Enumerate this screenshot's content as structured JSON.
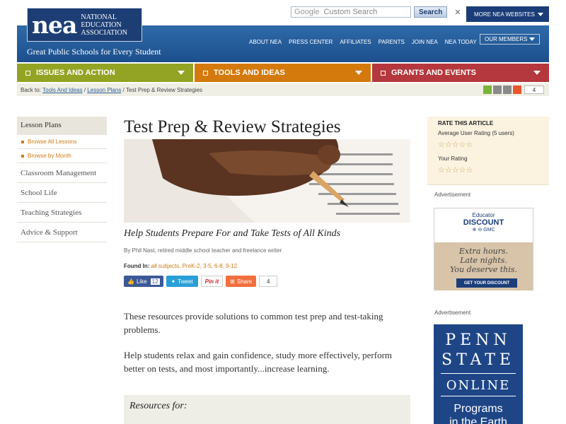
{
  "search": {
    "brand": "Google",
    "placeholder": "Custom Search",
    "button": "Search",
    "clear": "✕"
  },
  "more_sites": "MORE NEA WEBSITES",
  "logo": {
    "mark": "nea",
    "line1": "NATIONAL",
    "line2": "EDUCATION",
    "line3": "ASSOCIATION"
  },
  "tagline": "Great Public Schools for Every Student",
  "topnav": [
    "ABOUT NEA",
    "PRESS CENTER",
    "AFFILIATES",
    "PARENTS",
    "JOIN NEA",
    "NEA TODAY"
  ],
  "members": "OUR MEMBERS",
  "nav": [
    {
      "label": "ISSUES AND ACTION",
      "color": "#93a324"
    },
    {
      "label": "TOOLS AND IDEAS",
      "color": "#d47a0c"
    },
    {
      "label": "GRANTS AND EVENTS",
      "color": "#b4383d"
    }
  ],
  "breadcrumb": {
    "prefix": "Back to:",
    "link1": "Tools And Ideas",
    "sep1": " / ",
    "link2": "Lesson Plans",
    "sep2": " / ",
    "current": "Test Prep & Review Strategies"
  },
  "share_count": "4",
  "sidebar": {
    "heading": "Lesson Plans",
    "subs": [
      "Browse All Lessons",
      "Browse by Month"
    ],
    "items": [
      "Classroom Management",
      "School Life",
      "Teaching Strategies",
      "Advice & Support"
    ]
  },
  "article": {
    "title": "Test Prep & Review Strategies",
    "subtitle": "Help Students Prepare For and Take Tests of All Kinds",
    "byline": "By Phil Nast, retired middle school teacher and freelance writer",
    "found_label": "Found In:",
    "found_in": "all subjects, PreK-2, 3-5, 6-8, 9-12",
    "para1": "These resources provide solutions to common test prep and test-taking problems.",
    "para2": "Help students relax and gain confidence, study more effectively, perform better on tests, and most importantly...increase learning.",
    "resources": "Resources for:"
  },
  "social": {
    "like": "Like",
    "like_count": "12",
    "tweet": "Tweet",
    "pin": "Pin it",
    "share": "Share",
    "share_count": "4"
  },
  "rating": {
    "heading": "RATE THIS ARTICLE",
    "avg_label": "Average User Rating (5 users)",
    "your_label": "Your Rating",
    "avg_stars": "☆☆☆☆☆",
    "your_stars": "☆☆☆☆☆"
  },
  "ads": {
    "label1": "Advertisement",
    "label2": "Advertisement",
    "ad1": {
      "brand": "Educator",
      "title": "DISCOUNT",
      "cars": "⊕ ⊖ GMC",
      "copy1": "Extra hours.",
      "copy2": "Late nights.",
      "copy3": "You deserve this.",
      "button": "GET YOUR DISCOUNT"
    },
    "ad2": {
      "line1": "PENN",
      "line2": "STATE",
      "line3": "ONLINE",
      "prog1": "Programs",
      "prog2": "in the Earth"
    }
  }
}
